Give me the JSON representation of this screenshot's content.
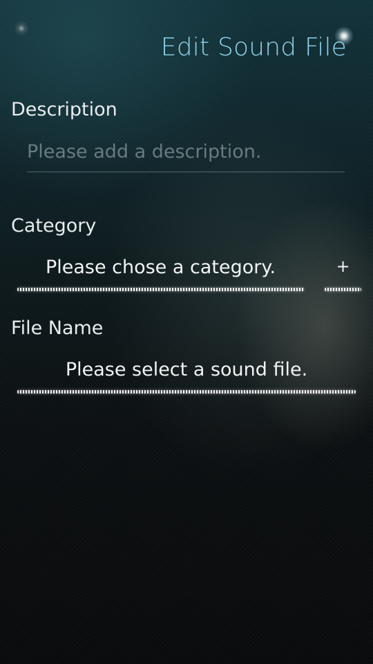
{
  "header": {
    "title": "Edit Sound File"
  },
  "description": {
    "label": "Description",
    "value": "",
    "placeholder": "Please add a description."
  },
  "category": {
    "label": "Category",
    "button_label": "Please chose a category.",
    "add_label": "+"
  },
  "file": {
    "label": "File Name",
    "button_label": "Please select a sound file."
  },
  "colors": {
    "accent": "#8fd4ea",
    "text": "#e8edef",
    "background_top": "#12323a",
    "background_bottom": "#090a0b"
  },
  "icons": {
    "corner_glow": "glow-dot-icon",
    "pulley_indicator": "pulley-menu-indicator-icon"
  }
}
